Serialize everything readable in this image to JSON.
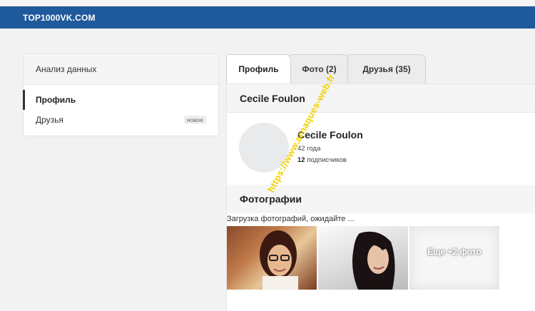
{
  "brand": "TOP1000VK.COM",
  "sidebar": {
    "header": "Анализ данных",
    "items": [
      {
        "label": "Профиль"
      },
      {
        "label": "Друзья",
        "badge": "новое"
      }
    ]
  },
  "tabs": [
    {
      "label": "Профиль"
    },
    {
      "label": "Фото (2)"
    },
    {
      "label": "Друзья (35)"
    }
  ],
  "profile": {
    "section_title": "Cecile Foulon",
    "name": "Cecile Foulon",
    "age": "42 года",
    "subscribers_count": "12",
    "subscribers_label": "подписчиков"
  },
  "photos": {
    "title": "Фотографии",
    "loading_text": "Загрузка фотографий, ожидайте ...",
    "more_label": "Еще +2 фото"
  },
  "watermark": "https://www.arnaques-web.fr",
  "colors": {
    "topbar": "#1f5a9c",
    "watermark": "#f0d000"
  }
}
